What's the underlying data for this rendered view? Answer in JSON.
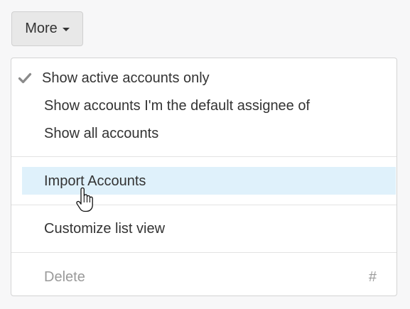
{
  "more_button": {
    "label": "More"
  },
  "menu": {
    "items": [
      {
        "label": "Show active accounts only",
        "checked": true
      },
      {
        "label": "Show accounts I'm the default assignee of",
        "checked": false
      },
      {
        "label": "Show all accounts",
        "checked": false
      },
      {
        "label": "Import Accounts",
        "hovered": true
      },
      {
        "label": "Customize list view"
      },
      {
        "label": "Delete",
        "disabled": true,
        "shortcut": "#"
      }
    ]
  },
  "icons": {
    "check": "check-icon",
    "caret": "caret-down-icon",
    "cursor": "hand-pointer-icon"
  },
  "colors": {
    "hover_background": "#dff1fb",
    "disabled_text": "#9a9a9a"
  }
}
